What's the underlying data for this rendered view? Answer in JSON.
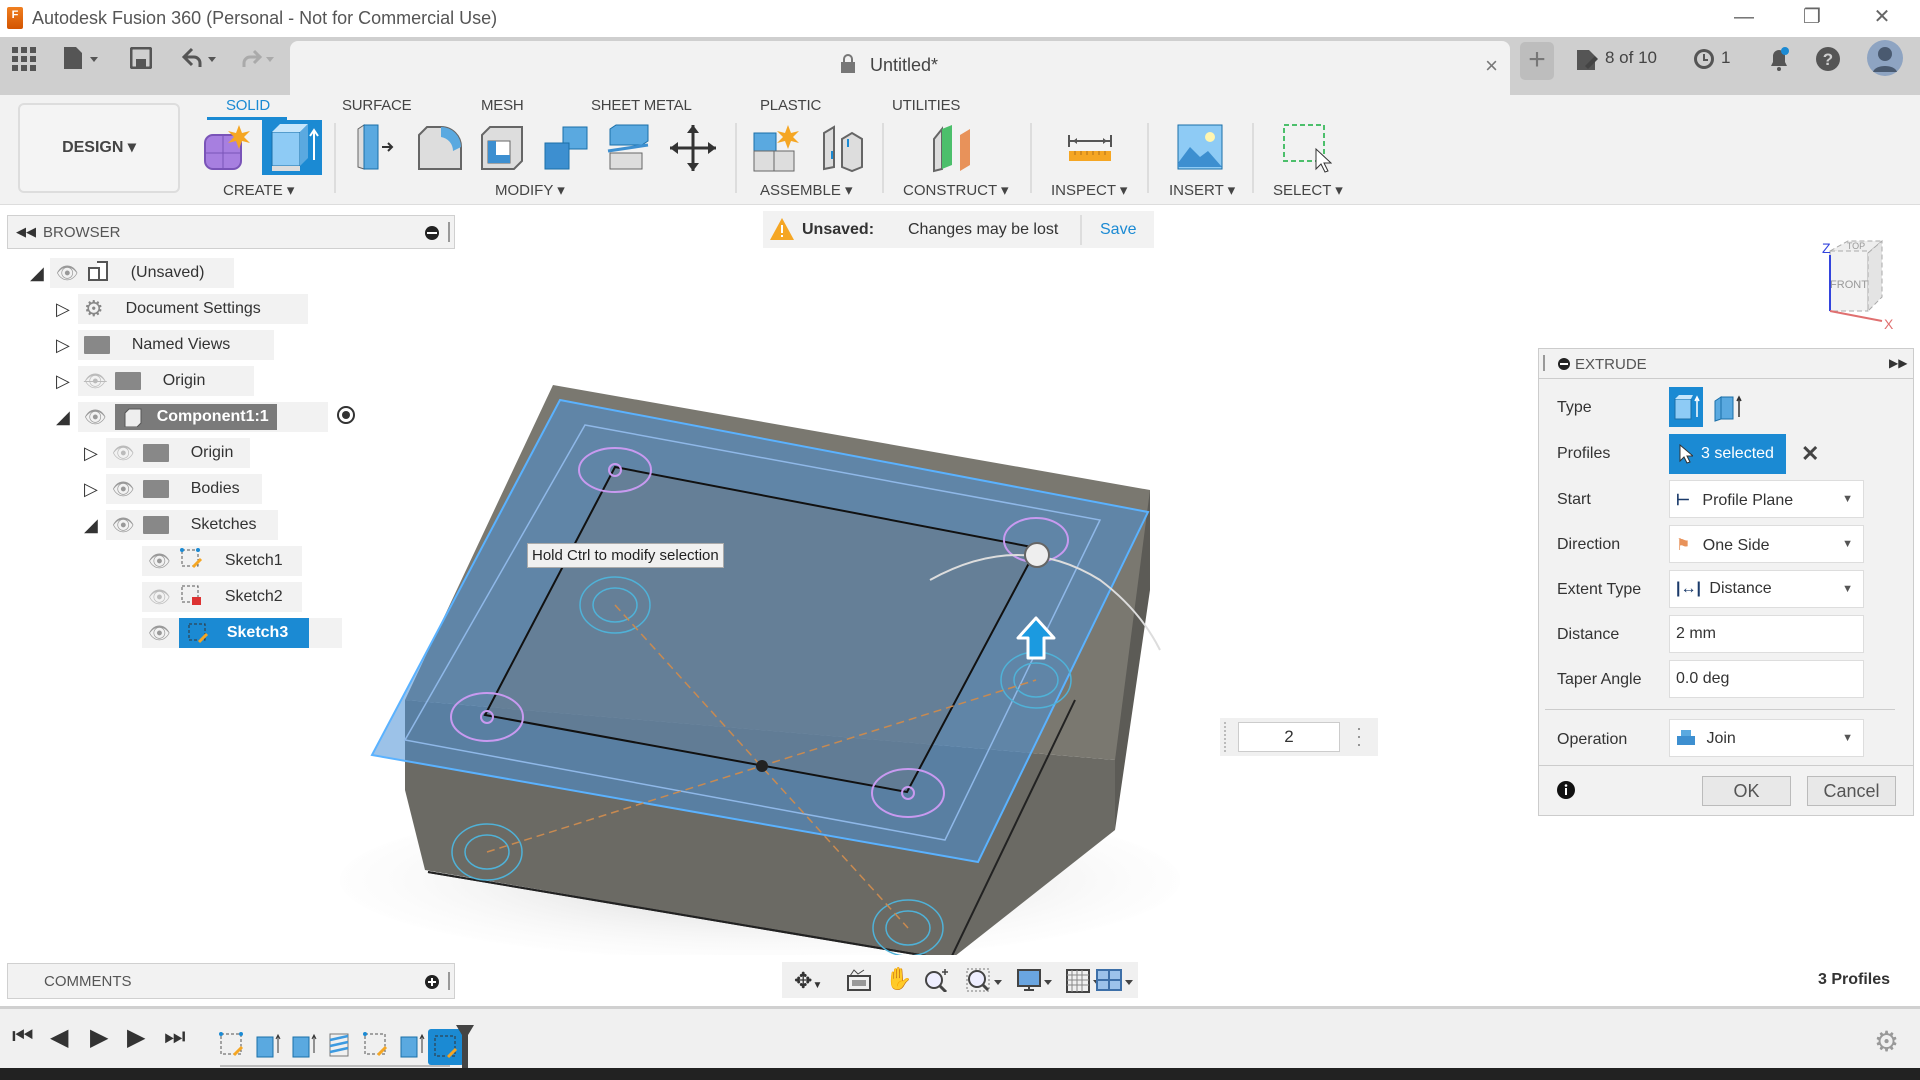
{
  "window": {
    "title": "Autodesk Fusion 360 (Personal - Not for Commercial Use)",
    "app_icon_letter": "F",
    "controls": {
      "minimize": "—",
      "restore": "❐",
      "close": "✕"
    }
  },
  "appbar": {
    "doc_tab": {
      "name": "Untitled*",
      "close": "×"
    },
    "new_tab": "+",
    "job_status": "8 of 10",
    "job_count": "1",
    "accent": "#1b8ad3"
  },
  "ribbon": {
    "workspace": "DESIGN ▾",
    "tabs": [
      {
        "label": "SOLID",
        "active": true
      },
      {
        "label": "SURFACE"
      },
      {
        "label": "MESH"
      },
      {
        "label": "SHEET METAL"
      },
      {
        "label": "PLASTIC"
      },
      {
        "label": "UTILITIES"
      }
    ],
    "groups": [
      "CREATE ▾",
      "MODIFY ▾",
      "ASSEMBLE ▾",
      "CONSTRUCT ▾",
      "INSPECT ▾",
      "INSERT ▾",
      "SELECT ▾"
    ]
  },
  "browser": {
    "title": "BROWSER",
    "items": [
      {
        "label": "(Unsaved)"
      },
      {
        "label": "Document Settings"
      },
      {
        "label": "Named Views"
      },
      {
        "label": "Origin"
      },
      {
        "label": "Component1:1"
      },
      {
        "label": "Origin"
      },
      {
        "label": "Bodies"
      },
      {
        "label": "Sketches"
      },
      {
        "label": "Sketch1"
      },
      {
        "label": "Sketch2"
      },
      {
        "label": "Sketch3",
        "selected": true
      }
    ]
  },
  "notice": {
    "label": "Unsaved:",
    "message": "Changes may be lost",
    "action": "Save"
  },
  "viewport": {
    "tooltip": "Hold Ctrl to modify selection",
    "distance_input": "2",
    "viewcube": {
      "top": "TOP",
      "front": "FRONT",
      "axis_z": "Z",
      "axis_x": "X"
    },
    "status": "3 Profiles"
  },
  "extrude": {
    "title": "EXTRUDE",
    "type_label": "Type",
    "profiles_label": "Profiles",
    "profiles_value": "3 selected",
    "start_label": "Start",
    "start_value": "Profile Plane",
    "direction_label": "Direction",
    "direction_value": "One Side",
    "extent_label": "Extent Type",
    "extent_value": "Distance",
    "distance_label": "Distance",
    "distance_value": "2 mm",
    "taper_label": "Taper Angle",
    "taper_value": "0.0 deg",
    "operation_label": "Operation",
    "operation_value": "Join",
    "ok": "OK",
    "cancel": "Cancel"
  },
  "comments": {
    "title": "COMMENTS"
  }
}
